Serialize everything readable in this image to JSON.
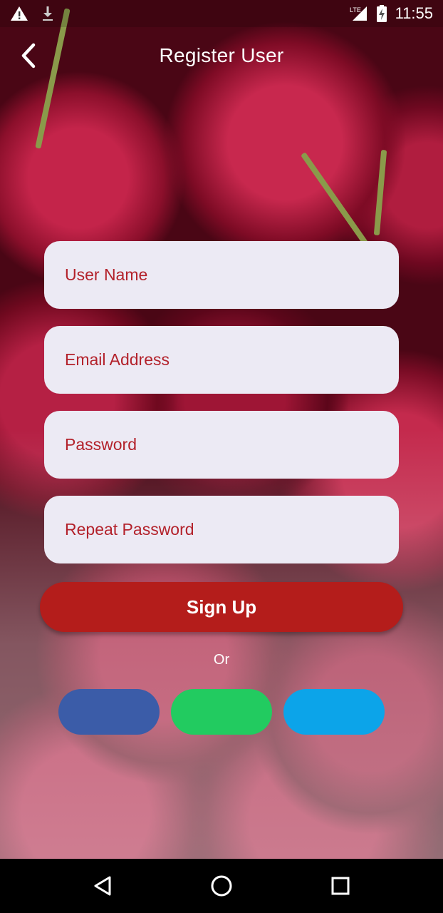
{
  "status_bar": {
    "time": "11:55",
    "network": "LTE",
    "icons": [
      "warning-icon",
      "download-icon",
      "signal-icon",
      "battery-charging-icon"
    ]
  },
  "app_bar": {
    "title": "Register User",
    "back_icon": "chevron-left-icon"
  },
  "form": {
    "username_placeholder": "User Name",
    "email_placeholder": "Email Address",
    "password_placeholder": "Password",
    "repeat_password_placeholder": "Repeat Password",
    "signup_label": "Sign Up",
    "or_label": "Or"
  },
  "social": {
    "facebook_color": "#3b5ca8",
    "whatsapp_color": "#22cb60",
    "twitter_color": "#0ca4e9"
  },
  "nav_bar": {
    "icons": [
      "back-triangle-icon",
      "home-circle-icon",
      "recents-square-icon"
    ]
  },
  "colors": {
    "accent": "#b41d1b",
    "field_bg": "#eceaf4",
    "field_text": "#b3222b"
  }
}
